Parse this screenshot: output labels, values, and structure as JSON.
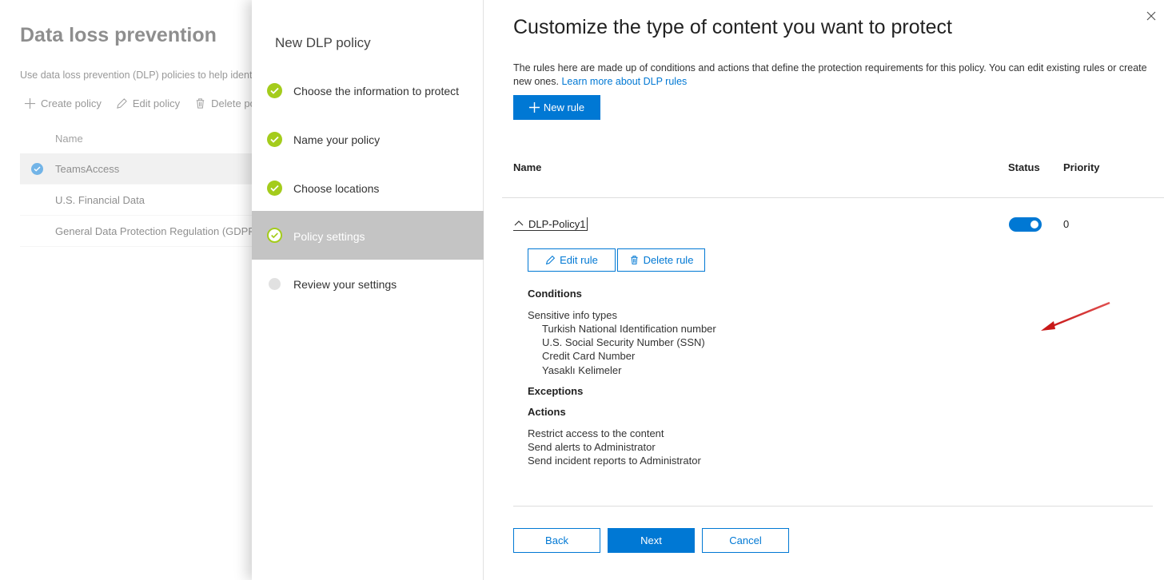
{
  "background": {
    "title": "Data loss prevention",
    "description": "Use data loss prevention (DLP) policies to help ident",
    "commands": [
      {
        "label": "Create policy",
        "icon": "plus-icon"
      },
      {
        "label": "Edit policy",
        "icon": "pencil-icon"
      },
      {
        "label": "Delete po",
        "icon": "trash-icon"
      }
    ],
    "list_header": "Name",
    "rows": [
      {
        "name": "TeamsAccess",
        "selected": true
      },
      {
        "name": "U.S. Financial Data",
        "selected": false
      },
      {
        "name": "General Data Protection Regulation (GDPR",
        "selected": false
      }
    ]
  },
  "wizard": {
    "title": "New DLP policy",
    "steps": [
      {
        "label": "Choose the information to protect",
        "state": "done"
      },
      {
        "label": "Name your policy",
        "state": "done"
      },
      {
        "label": "Choose locations",
        "state": "done"
      },
      {
        "label": "Policy settings",
        "state": "active"
      },
      {
        "label": "Review your settings",
        "state": "todo"
      }
    ]
  },
  "main": {
    "heading": "Customize the type of content you want to protect",
    "description": "The rules here are made up of conditions and actions that define the protection requirements for this policy. You can edit existing rules or create new ones.",
    "learn_more": "Learn more about DLP rules",
    "new_rule_label": "New rule",
    "columns": {
      "name": "Name",
      "status": "Status",
      "priority": "Priority"
    },
    "rule": {
      "name": "DLP-Policy1",
      "enabled": true,
      "priority": "0",
      "edit_label": "Edit rule",
      "delete_label": "Delete rule",
      "conditions_heading": "Conditions",
      "sensitive_info_label": "Sensitive info types",
      "sensitive_info_types": [
        "Turkish National Identification number",
        "U.S. Social Security Number (SSN)",
        "Credit Card Number",
        "Yasaklı Kelimeler"
      ],
      "exceptions_heading": "Exceptions",
      "actions_heading": "Actions",
      "actions": [
        "Restrict access to the content",
        "Send alerts to Administrator",
        "Send incident reports to Administrator"
      ]
    },
    "footer": {
      "back": "Back",
      "next": "Next",
      "cancel": "Cancel"
    }
  },
  "colors": {
    "accent": "#0078d4",
    "step_done": "#a4cc1c",
    "annotation_arrow": "#d42020"
  }
}
